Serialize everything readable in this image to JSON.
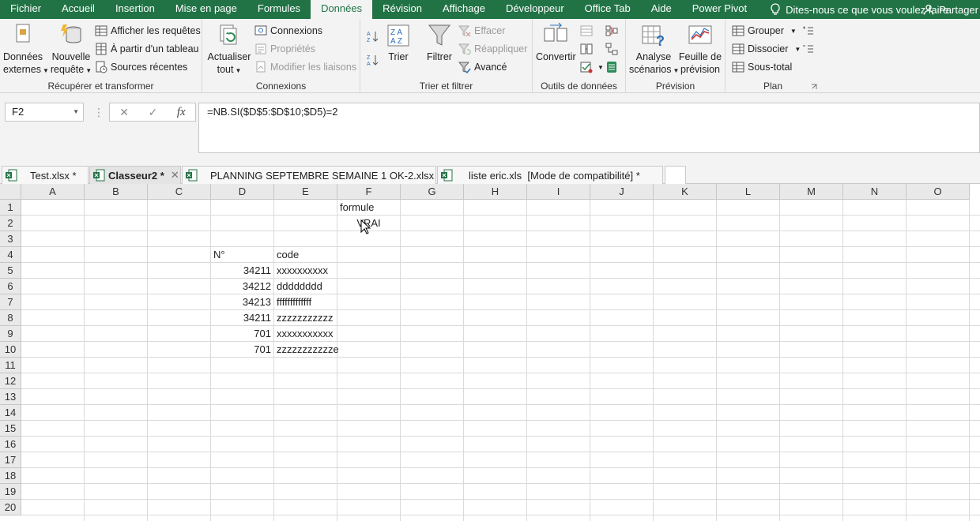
{
  "menu": {
    "tabs": [
      "Fichier",
      "Accueil",
      "Insertion",
      "Mise en page",
      "Formules",
      "Données",
      "Révision",
      "Affichage",
      "Développeur",
      "Office Tab",
      "Aide",
      "Power Pivot"
    ],
    "active_tab": "Données",
    "tell_me": "Dites-nous ce que vous voulez faire",
    "share": "Partager"
  },
  "ribbon": {
    "get_transform": {
      "label": "Récupérer et transformer",
      "external_data": [
        "Données",
        "externes"
      ],
      "new_query": [
        "Nouvelle",
        "requête"
      ],
      "show_queries": "Afficher les requêtes",
      "from_table": "À partir d'un tableau",
      "recent_sources": "Sources récentes"
    },
    "connections": {
      "label": "Connexions",
      "refresh_all": [
        "Actualiser",
        "tout"
      ],
      "connections": "Connexions",
      "properties": "Propriétés",
      "edit_links": "Modifier les liaisons"
    },
    "sort_filter": {
      "label": "Trier et filtrer",
      "sort": "Trier",
      "filter": "Filtrer",
      "clear": "Effacer",
      "reapply": "Réappliquer",
      "advanced": "Avancé"
    },
    "data_tools": {
      "label": "Outils de données",
      "convert": "Convertir"
    },
    "forecast": {
      "label": "Prévision",
      "what_if": [
        "Analyse",
        "scénarios"
      ],
      "forecast_sheet": [
        "Feuille de",
        "prévision"
      ]
    },
    "outline": {
      "label": "Plan",
      "group": "Grouper",
      "ungroup": "Dissocier",
      "subtotal": "Sous-total"
    }
  },
  "formula_bar": {
    "name_box": "F2",
    "formula": "=NB.SI($D$5:$D$10;$D5)=2"
  },
  "workbook_tabs": [
    {
      "name": "Test.xlsx *",
      "active": false
    },
    {
      "name": "Classeur2 *",
      "active": true
    },
    {
      "name": "PLANNING SEPTEMBRE SEMAINE 1 OK-2.xlsx",
      "active": false
    },
    {
      "name": "liste eric.xls  [Mode de compatibilité] *",
      "active": false
    }
  ],
  "sheet": {
    "columns": [
      "A",
      "B",
      "C",
      "D",
      "E",
      "F",
      "G",
      "H",
      "I",
      "J",
      "K",
      "L",
      "M",
      "N",
      "O"
    ],
    "rows": [
      "1",
      "2",
      "3",
      "4",
      "5",
      "6",
      "7",
      "8",
      "9",
      "10",
      "11",
      "12",
      "13",
      "14",
      "15",
      "16",
      "17",
      "18",
      "19",
      "20"
    ],
    "cells": {
      "F1": "formule",
      "F2": "VRAI",
      "D4": "N°",
      "E4": "code",
      "D5": "34211",
      "E5": "xxxxxxxxxx",
      "D6": "34212",
      "E6": "dddddddd",
      "D7": "34213",
      "E7": "fffffffffffff",
      "D8": "34211",
      "E8": "zzzzzzzzzzz",
      "D9": "701",
      "E9": "xxxxxxxxxxx",
      "D10": "701",
      "E10": "zzzzzzzzzzze"
    }
  },
  "colors": {
    "accent": "#217346",
    "ribbon_bg": "#f3f3f3",
    "header_bg": "#e9e9e9",
    "gridline": "#dadada"
  }
}
